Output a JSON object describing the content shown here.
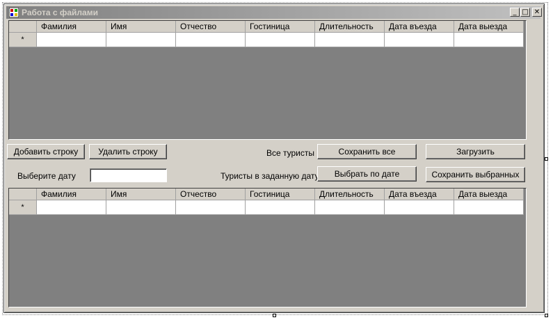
{
  "window": {
    "title": "Работа с файлами",
    "caption_buttons": {
      "minimize": "_",
      "maximize": "□",
      "close": "✕"
    }
  },
  "grid_columns": [
    "Фамилия",
    "Имя",
    "Отчество",
    "Гостиница",
    "Длительность",
    "Дата въезда",
    "Дата выезда"
  ],
  "new_row_marker": "*",
  "top_grid": {
    "rows": []
  },
  "bottom_grid": {
    "rows": []
  },
  "controls": {
    "add_row": "Добавить строку",
    "delete_row": "Удалить строку",
    "all_tourists_label": "Все туристы",
    "save_all": "Сохранить все",
    "load": "Загрузить",
    "choose_date_label": "Выберите дату",
    "date_input_value": "",
    "tourists_by_date_label": "Туристы в заданную дату",
    "select_by_date": "Выбрать по дате",
    "save_selected": "Сохранить выбранных"
  }
}
